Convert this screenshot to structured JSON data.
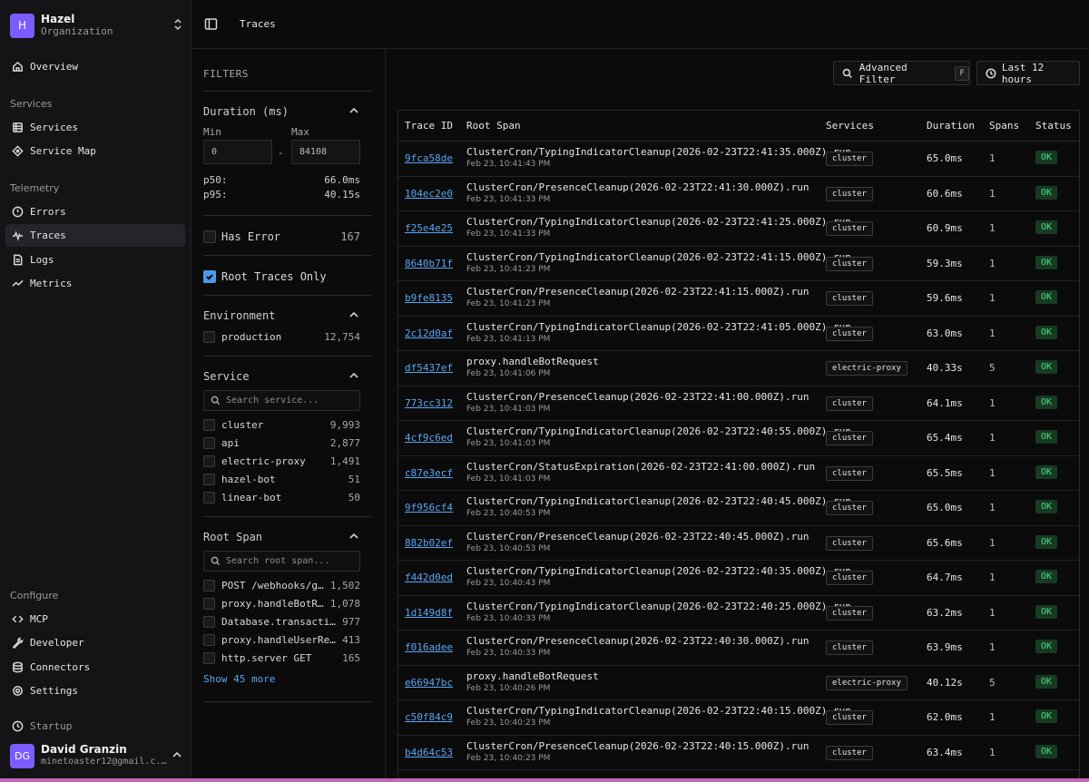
{
  "org": {
    "avatar": "H",
    "name": "Hazel",
    "subtitle": "Organization"
  },
  "nav": {
    "overview": "Overview",
    "services_section": "Services",
    "services": "Services",
    "service_map": "Service Map",
    "telemetry_section": "Telemetry",
    "errors": "Errors",
    "traces": "Traces",
    "logs": "Logs",
    "metrics": "Metrics",
    "configure_section": "Configure",
    "mcp": "MCP",
    "developer": "Developer",
    "connectors": "Connectors",
    "settings": "Settings",
    "plan": "Startup"
  },
  "user": {
    "initials": "DG",
    "name": "David Granzin",
    "email": "minetoaster12@gmail.c..."
  },
  "topbar": {
    "title": "Traces"
  },
  "filters": {
    "heading": "FILTERS",
    "duration": {
      "title": "Duration (ms)",
      "min_label": "Min",
      "max_label": "Max",
      "min_value": "0",
      "max_value": "84108",
      "p50_label": "p50:",
      "p50_value": "66.0ms",
      "p95_label": "p95:",
      "p95_value": "40.15s"
    },
    "has_error": {
      "label": "Has Error",
      "count": "167"
    },
    "root_only": {
      "label": "Root Traces Only",
      "checked": true
    },
    "environment": {
      "title": "Environment",
      "items": [
        {
          "label": "production",
          "count": "12,754"
        }
      ]
    },
    "service": {
      "title": "Service",
      "placeholder": "Search service...",
      "items": [
        {
          "label": "cluster",
          "count": "9,993"
        },
        {
          "label": "api",
          "count": "2,877"
        },
        {
          "label": "electric-proxy",
          "count": "1,491"
        },
        {
          "label": "hazel-bot",
          "count": "51"
        },
        {
          "label": "linear-bot",
          "count": "50"
        }
      ]
    },
    "root_span": {
      "title": "Root Span",
      "placeholder": "Search root span...",
      "items": [
        {
          "label": "POST /webhooks/github",
          "count": "1,502"
        },
        {
          "label": "proxy.handleBotRequest",
          "count": "1,078"
        },
        {
          "label": "Database.transaction",
          "count": "977"
        },
        {
          "label": "proxy.handleUserRequest",
          "count": "413"
        },
        {
          "label": "http.server GET",
          "count": "165"
        }
      ],
      "show_more": "Show 45 more"
    }
  },
  "toolbar": {
    "advanced_filter": "Advanced Filter",
    "shortcut": "F",
    "time_range": "Last 12 hours"
  },
  "table": {
    "headers": {
      "id": "Trace ID",
      "span": "Root Span",
      "services": "Services",
      "duration": "Duration",
      "spans": "Spans",
      "status": "Status"
    },
    "rows": [
      {
        "id": "9fca58de",
        "span": "ClusterCron/TypingIndicatorCleanup(2026-02-23T22:41:35.000Z).run",
        "time": "Feb 23, 10:41:43 PM",
        "service": "cluster",
        "duration": "65.0ms",
        "spans": "1",
        "status": "OK"
      },
      {
        "id": "104ec2e0",
        "span": "ClusterCron/PresenceCleanup(2026-02-23T22:41:30.000Z).run",
        "time": "Feb 23, 10:41:33 PM",
        "service": "cluster",
        "duration": "60.6ms",
        "spans": "1",
        "status": "OK"
      },
      {
        "id": "f25e4e25",
        "span": "ClusterCron/TypingIndicatorCleanup(2026-02-23T22:41:25.000Z).run",
        "time": "Feb 23, 10:41:33 PM",
        "service": "cluster",
        "duration": "60.9ms",
        "spans": "1",
        "status": "OK"
      },
      {
        "id": "8640b71f",
        "span": "ClusterCron/TypingIndicatorCleanup(2026-02-23T22:41:15.000Z).run",
        "time": "Feb 23, 10:41:23 PM",
        "service": "cluster",
        "duration": "59.3ms",
        "spans": "1",
        "status": "OK"
      },
      {
        "id": "b9fe8135",
        "span": "ClusterCron/PresenceCleanup(2026-02-23T22:41:15.000Z).run",
        "time": "Feb 23, 10:41:23 PM",
        "service": "cluster",
        "duration": "59.6ms",
        "spans": "1",
        "status": "OK"
      },
      {
        "id": "2c12d0af",
        "span": "ClusterCron/TypingIndicatorCleanup(2026-02-23T22:41:05.000Z).run",
        "time": "Feb 23, 10:41:13 PM",
        "service": "cluster",
        "duration": "63.0ms",
        "spans": "1",
        "status": "OK"
      },
      {
        "id": "df5437ef",
        "span": "proxy.handleBotRequest",
        "time": "Feb 23, 10:41:06 PM",
        "service": "electric-proxy",
        "duration": "40.33s",
        "spans": "5",
        "status": "OK"
      },
      {
        "id": "773cc312",
        "span": "ClusterCron/PresenceCleanup(2026-02-23T22:41:00.000Z).run",
        "time": "Feb 23, 10:41:03 PM",
        "service": "cluster",
        "duration": "64.1ms",
        "spans": "1",
        "status": "OK"
      },
      {
        "id": "4cf9c6ed",
        "span": "ClusterCron/TypingIndicatorCleanup(2026-02-23T22:40:55.000Z).run",
        "time": "Feb 23, 10:41:03 PM",
        "service": "cluster",
        "duration": "65.4ms",
        "spans": "1",
        "status": "OK"
      },
      {
        "id": "c87e3ecf",
        "span": "ClusterCron/StatusExpiration(2026-02-23T22:41:00.000Z).run",
        "time": "Feb 23, 10:41:03 PM",
        "service": "cluster",
        "duration": "65.5ms",
        "spans": "1",
        "status": "OK"
      },
      {
        "id": "9f956cf4",
        "span": "ClusterCron/TypingIndicatorCleanup(2026-02-23T22:40:45.000Z).run",
        "time": "Feb 23, 10:40:53 PM",
        "service": "cluster",
        "duration": "65.0ms",
        "spans": "1",
        "status": "OK"
      },
      {
        "id": "882b02ef",
        "span": "ClusterCron/PresenceCleanup(2026-02-23T22:40:45.000Z).run",
        "time": "Feb 23, 10:40:53 PM",
        "service": "cluster",
        "duration": "65.6ms",
        "spans": "1",
        "status": "OK"
      },
      {
        "id": "f442d0ed",
        "span": "ClusterCron/TypingIndicatorCleanup(2026-02-23T22:40:35.000Z).run",
        "time": "Feb 23, 10:40:43 PM",
        "service": "cluster",
        "duration": "64.7ms",
        "spans": "1",
        "status": "OK"
      },
      {
        "id": "1d149d8f",
        "span": "ClusterCron/TypingIndicatorCleanup(2026-02-23T22:40:25.000Z).run",
        "time": "Feb 23, 10:40:33 PM",
        "service": "cluster",
        "duration": "63.2ms",
        "spans": "1",
        "status": "OK"
      },
      {
        "id": "f016adee",
        "span": "ClusterCron/PresenceCleanup(2026-02-23T22:40:30.000Z).run",
        "time": "Feb 23, 10:40:33 PM",
        "service": "cluster",
        "duration": "63.9ms",
        "spans": "1",
        "status": "OK"
      },
      {
        "id": "e66947bc",
        "span": "proxy.handleBotRequest",
        "time": "Feb 23, 10:40:26 PM",
        "service": "electric-proxy",
        "duration": "40.12s",
        "spans": "5",
        "status": "OK"
      },
      {
        "id": "c50f84c9",
        "span": "ClusterCron/TypingIndicatorCleanup(2026-02-23T22:40:15.000Z).run",
        "time": "Feb 23, 10:40:23 PM",
        "service": "cluster",
        "duration": "62.0ms",
        "spans": "1",
        "status": "OK"
      },
      {
        "id": "b4d64c53",
        "span": "ClusterCron/PresenceCleanup(2026-02-23T22:40:15.000Z).run",
        "time": "Feb 23, 10:40:23 PM",
        "service": "cluster",
        "duration": "63.4ms",
        "spans": "1",
        "status": "OK"
      }
    ]
  },
  "colors": {
    "accent": "#7c5cff",
    "link": "#5aa6f2",
    "ok": "#4ade80",
    "ok_bg": "#173a22",
    "checkbox": "#4c9be8"
  }
}
